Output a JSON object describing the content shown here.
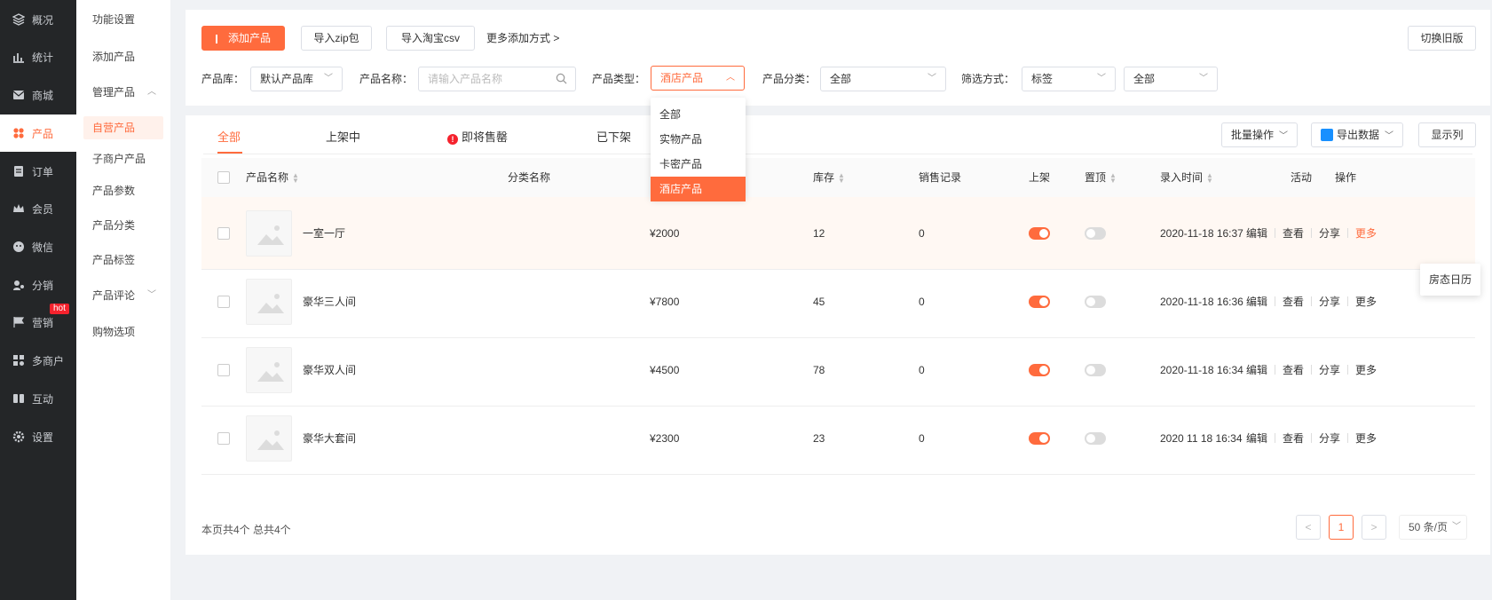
{
  "nav": {
    "items": [
      {
        "label": "概况",
        "icon": "layers-icon"
      },
      {
        "label": "统计",
        "icon": "chart-icon"
      },
      {
        "label": "商城",
        "icon": "mail-icon"
      },
      {
        "label": "产品",
        "icon": "grid-icon"
      },
      {
        "label": "订单",
        "icon": "order-icon"
      },
      {
        "label": "会员",
        "icon": "crown-icon"
      },
      {
        "label": "微信",
        "icon": "wechat-icon"
      },
      {
        "label": "分销",
        "icon": "distribution-icon"
      },
      {
        "label": "营销",
        "icon": "flag-icon"
      },
      {
        "label": "多商户",
        "icon": "merchant-icon"
      },
      {
        "label": "互动",
        "icon": "interaction-icon"
      },
      {
        "label": "设置",
        "icon": "gear-icon"
      }
    ],
    "hot_badge": "hot",
    "accent": "#ff6b3d"
  },
  "submenu": {
    "items": [
      "功能设置",
      "添加产品",
      "管理产品",
      "自营产品",
      "子商户产品",
      "产品参数",
      "产品分类",
      "产品标签",
      "产品评论",
      "购物选项"
    ]
  },
  "toolbar": {
    "add_product": "添加产品",
    "import_zip": "导入zip包",
    "import_taobao": "导入淘宝csv",
    "more_add": "更多添加方式 >",
    "switch_old": "切换旧版"
  },
  "filters": {
    "library_label": "产品库：",
    "library_value": "默认产品库",
    "name_label": "产品名称：",
    "name_placeholder": "请输入产品名称",
    "type_label": "产品类型：",
    "type_value": "酒店产品",
    "category_label": "产品分类：",
    "category_value": "全部",
    "filter_label": "筛选方式：",
    "filter_value": "标签",
    "filter_value2": "全部"
  },
  "type_dropdown": {
    "options": [
      "全部",
      "实物产品",
      "卡密产品",
      "酒店产品"
    ],
    "selected": "酒店产品"
  },
  "tabs": [
    "全部",
    "上架中",
    "即将售罄",
    "已下架"
  ],
  "warn_glyph": "!",
  "actions": {
    "batch": "批量操作",
    "export": "导出数据",
    "columns": "显示列"
  },
  "table": {
    "headers": {
      "name": "产品名称",
      "category": "分类名称",
      "stock": "库存",
      "sales": "销售记录",
      "shelf": "上架",
      "top": "置顶",
      "time": "录入时间",
      "activity": "活动",
      "ops": "操作"
    },
    "rows": [
      {
        "name": "一室一厅",
        "price": "¥2000",
        "stock": "12",
        "sales": "0",
        "shelf": true,
        "top": false,
        "time": "2020-11-18 16:37"
      },
      {
        "name": "豪华三人间",
        "price": "¥7800",
        "stock": "45",
        "sales": "0",
        "shelf": true,
        "top": false,
        "time": "2020-11-18 16:36"
      },
      {
        "name": "豪华双人间",
        "price": "¥4500",
        "stock": "78",
        "sales": "0",
        "shelf": true,
        "top": false,
        "time": "2020-11-18 16:34"
      },
      {
        "name": "豪华大套间",
        "price": "¥2300",
        "stock": "23",
        "sales": "0",
        "shelf": true,
        "top": false,
        "time": "2020 11 18 16:34"
      }
    ],
    "ops": [
      "编辑",
      "查看",
      "分享",
      "更多"
    ]
  },
  "tooltip": "房态日历",
  "footer": {
    "summary": "本页共4个 总共4个",
    "prev": "<",
    "page": "1",
    "next": ">",
    "page_size": "50 条/页"
  }
}
